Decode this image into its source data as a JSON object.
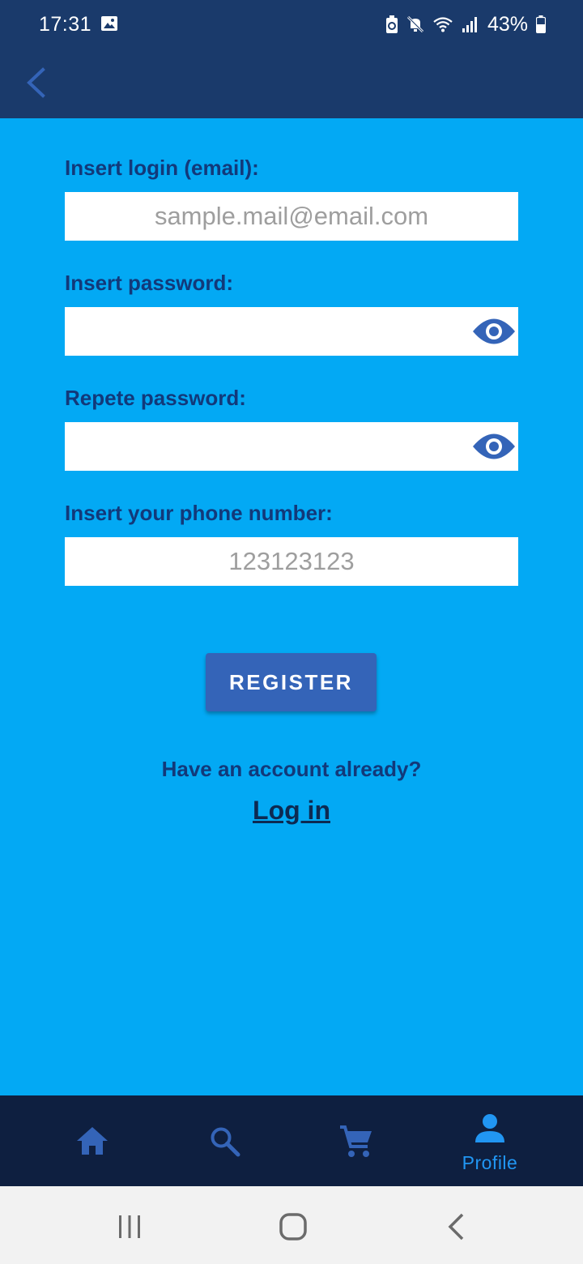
{
  "status_bar": {
    "time": "17:31",
    "battery": "43%",
    "icons": [
      "gallery-icon",
      "battery-saver-icon",
      "mute-icon",
      "wifi-icon",
      "signal-icon",
      "battery-icon"
    ]
  },
  "app_bar": {
    "back_icon": "chevron-left-icon"
  },
  "form": {
    "email": {
      "label": "Insert login (email):",
      "placeholder": "sample.mail@email.com",
      "value": ""
    },
    "password": {
      "label": "Insert password:",
      "placeholder": "",
      "value": "",
      "toggle_icon": "eye-icon"
    },
    "repeat_password": {
      "label": "Repete password:",
      "placeholder": "",
      "value": "",
      "toggle_icon": "eye-icon"
    },
    "phone": {
      "label": "Insert your phone number:",
      "placeholder": "123123123",
      "value": ""
    },
    "register_label": "REGISTER",
    "have_account_text": "Have an account already?",
    "login_link": "Log in"
  },
  "bottom_nav": {
    "items": [
      {
        "icon": "home-icon",
        "label": ""
      },
      {
        "icon": "search-icon",
        "label": ""
      },
      {
        "icon": "cart-icon",
        "label": ""
      },
      {
        "icon": "person-icon",
        "label": "Profile",
        "active": true
      }
    ]
  },
  "system_nav": {
    "buttons": [
      "recent-apps-icon",
      "home-circle-icon",
      "back-icon"
    ]
  },
  "colors": {
    "background": "#03a9f4",
    "app_bar": "#1a3a6b",
    "label_text": "#12397a",
    "button": "#3464b8",
    "bottom_nav": "#0e1f40",
    "nav_icon": "#3464b8",
    "nav_active": "#2196f3",
    "system_nav": "#f2f2f2"
  }
}
